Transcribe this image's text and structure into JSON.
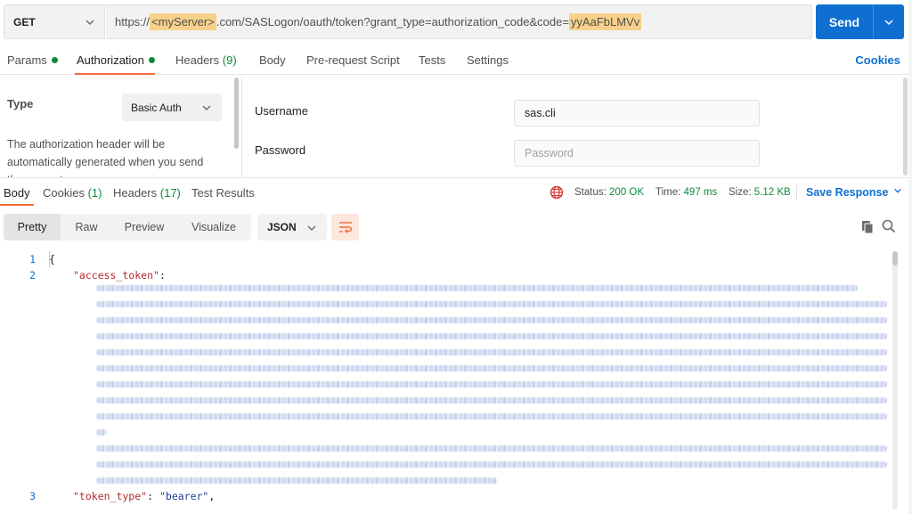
{
  "request": {
    "method": "GET",
    "url_prefix": "https://",
    "url_server": "<myServer>",
    "url_middle": ".com/SASLogon/oauth/token?grant_type=authorization_code&code=",
    "url_code": "yyAaFbLMVv",
    "send_label": "Send"
  },
  "request_tabs": [
    {
      "label": "Params",
      "count": "",
      "dot": true
    },
    {
      "label": "Authorization",
      "count": "",
      "dot": true
    },
    {
      "label": "Headers",
      "count": "(9)",
      "dot": false
    },
    {
      "label": "Body",
      "count": "",
      "dot": false
    },
    {
      "label": "Pre-request Script",
      "count": "",
      "dot": false
    },
    {
      "label": "Tests",
      "count": "",
      "dot": false
    },
    {
      "label": "Settings",
      "count": "",
      "dot": false
    }
  ],
  "cookies_link": "Cookies",
  "auth": {
    "type_label": "Type",
    "type_value": "Basic Auth",
    "description": "The authorization header will be automatically generated when you send the request.",
    "username_label": "Username",
    "username_value": "sas.cli",
    "password_label": "Password",
    "password_placeholder": "Password"
  },
  "response_tabs": [
    {
      "label": "Body",
      "count": ""
    },
    {
      "label": "Cookies",
      "count": "(1)"
    },
    {
      "label": "Headers",
      "count": "(17)"
    },
    {
      "label": "Test Results",
      "count": ""
    }
  ],
  "response_meta": {
    "status_label": "Status:",
    "status_value": "200 OK",
    "time_label": "Time:",
    "time_value": "497 ms",
    "size_label": "Size:",
    "size_value": "5.12 KB",
    "save_label": "Save Response"
  },
  "view_modes": [
    "Pretty",
    "Raw",
    "Preview",
    "Visualize"
  ],
  "active_view": "Pretty",
  "format": "JSON",
  "code": {
    "line_numbers": [
      "1",
      "2",
      "3"
    ],
    "open_brace": "{",
    "key1": "\"access_token\"",
    "key3": "\"token_type\"",
    "value3": "\"bearer\"",
    "colon": ":",
    "comma": ","
  },
  "colors": {
    "accent": "#f26b3a",
    "send_blue": "#0f6fd1",
    "success_green": "#0c8a3e",
    "highlight": "#f7d18b"
  }
}
